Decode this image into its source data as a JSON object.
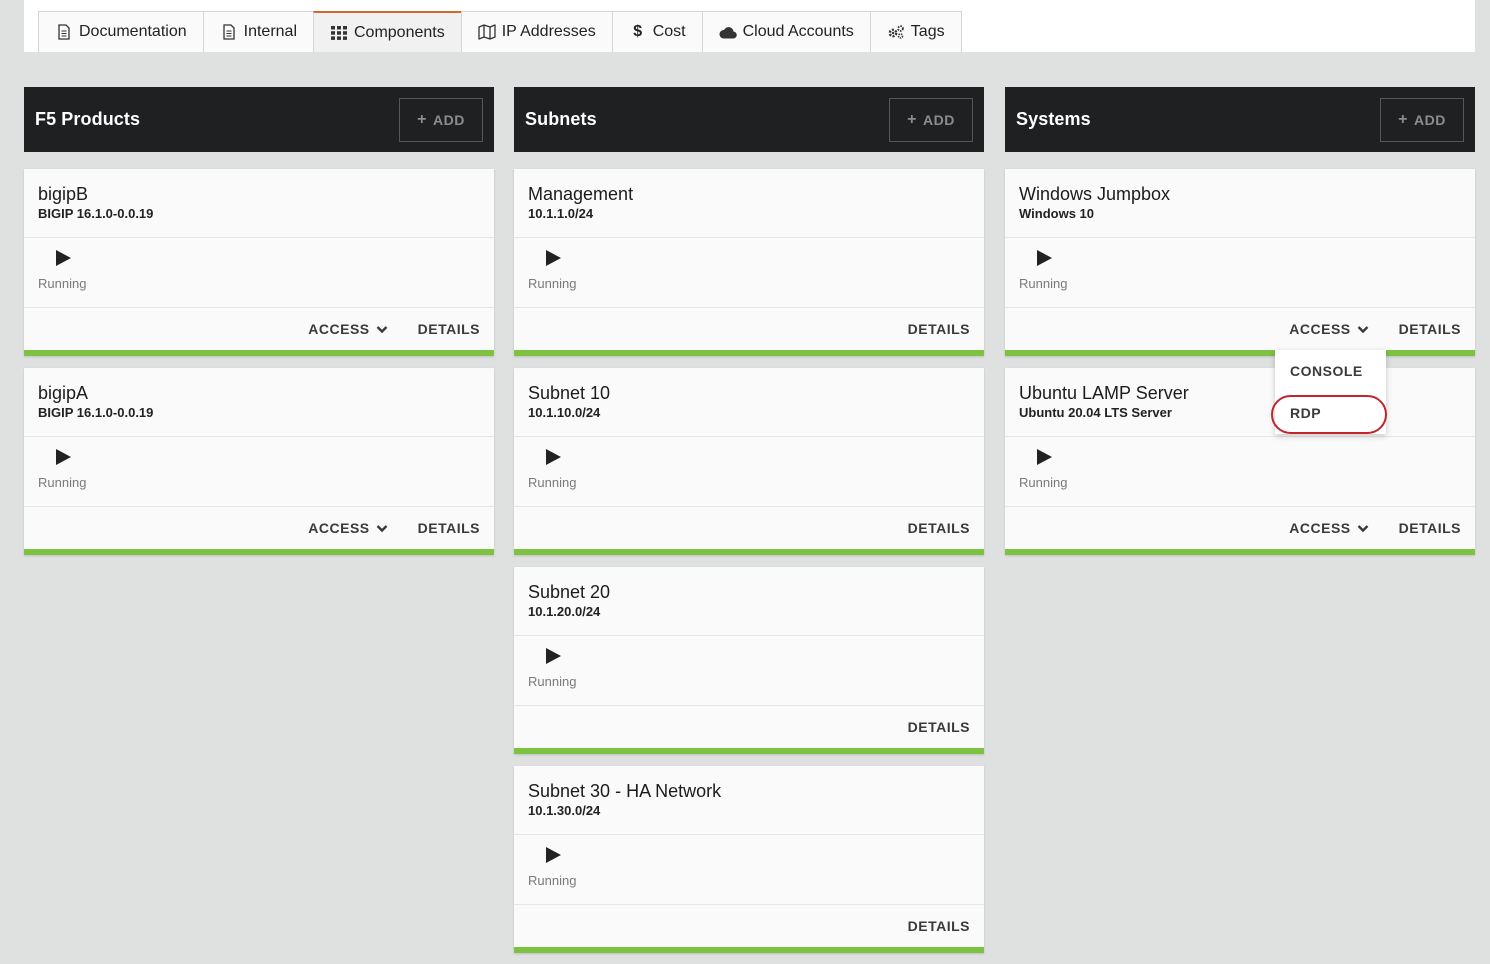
{
  "tabs": [
    {
      "label": "Documentation",
      "icon": "document-icon"
    },
    {
      "label": "Internal",
      "icon": "document-icon"
    },
    {
      "label": "Components",
      "icon": "grid-icon",
      "active": true
    },
    {
      "label": "IP Addresses",
      "icon": "map-icon"
    },
    {
      "label": "Cost",
      "icon": "dollar-icon"
    },
    {
      "label": "Cloud Accounts",
      "icon": "cloud-icon"
    },
    {
      "label": "Tags",
      "icon": "gears-icon"
    }
  ],
  "columns": {
    "f5": {
      "title": "F5 Products",
      "add_label": "ADD",
      "cards": [
        {
          "name": "bigipB",
          "sub": "BIGIP 16.1.0-0.0.19",
          "status": "Running",
          "access": "ACCESS",
          "details": "DETAILS"
        },
        {
          "name": "bigipA",
          "sub": "BIGIP 16.1.0-0.0.19",
          "status": "Running",
          "access": "ACCESS",
          "details": "DETAILS"
        }
      ]
    },
    "subnets": {
      "title": "Subnets",
      "add_label": "ADD",
      "cards": [
        {
          "name": "Management",
          "sub": "10.1.1.0/24",
          "status": "Running",
          "details": "DETAILS"
        },
        {
          "name": "Subnet 10",
          "sub": "10.1.10.0/24",
          "status": "Running",
          "details": "DETAILS"
        },
        {
          "name": "Subnet 20",
          "sub": "10.1.20.0/24",
          "status": "Running",
          "details": "DETAILS"
        },
        {
          "name": "Subnet 30 - HA Network",
          "sub": "10.1.30.0/24",
          "status": "Running",
          "details": "DETAILS"
        }
      ]
    },
    "systems": {
      "title": "Systems",
      "add_label": "ADD",
      "cards": [
        {
          "name": "Windows Jumpbox",
          "sub": "Windows 10",
          "status": "Running",
          "access": "ACCESS",
          "details": "DETAILS"
        },
        {
          "name": "Ubuntu LAMP Server",
          "sub": "Ubuntu 20.04 LTS Server",
          "status": "Running",
          "access": "ACCESS",
          "details": "DETAILS"
        }
      ]
    }
  },
  "access_dropdown": {
    "items": [
      "CONSOLE",
      "RDP"
    ],
    "highlighted": "RDP"
  },
  "colors": {
    "header_bg": "#1f2021",
    "status_bar": "#7dc242",
    "active_tab_accent": "#d9662b",
    "highlight_ring": "#c2242b"
  }
}
